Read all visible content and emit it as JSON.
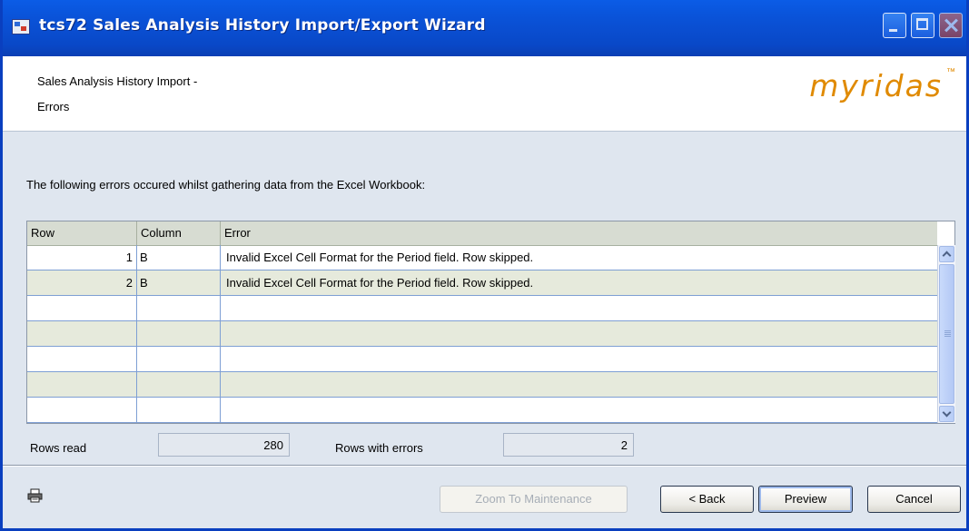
{
  "window": {
    "title": "tcs72 Sales Analysis History Import/Export Wizard"
  },
  "header": {
    "heading_line1": "Sales Analysis History Import -",
    "heading_line2": "Errors",
    "logo_text": "myridas",
    "logo_tm": "™",
    "logo_color": "#e08a00"
  },
  "intro_text": "The following errors occured whilst gathering data from the Excel Workbook:",
  "grid": {
    "columns": [
      "Row",
      "Column",
      "Error"
    ],
    "rows": [
      {
        "row": "1",
        "column": "B",
        "error": "Invalid Excel Cell Format for the Period field. Row skipped."
      },
      {
        "row": "2",
        "column": "B",
        "error": "Invalid Excel Cell Format for the Period field. Row skipped."
      },
      {
        "row": "",
        "column": "",
        "error": ""
      },
      {
        "row": "",
        "column": "",
        "error": ""
      },
      {
        "row": "",
        "column": "",
        "error": ""
      },
      {
        "row": "",
        "column": "",
        "error": ""
      },
      {
        "row": "",
        "column": "",
        "error": ""
      }
    ]
  },
  "stats": {
    "rows_read_label": "Rows read",
    "rows_read_value": "280",
    "rows_with_errors_label": "Rows with errors",
    "rows_with_errors_value": "2"
  },
  "footer": {
    "print_icon": "printer-icon",
    "zoom_label": "Zoom To Maintenance",
    "back_label": "< Back",
    "preview_label": "Preview",
    "cancel_label": "Cancel"
  }
}
